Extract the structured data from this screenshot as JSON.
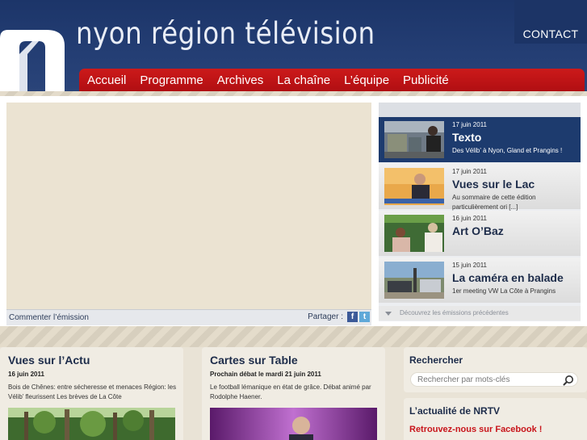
{
  "header": {
    "site_title": "nyon région télévision",
    "contact_label": "CONTACT"
  },
  "nav": {
    "items": [
      "Accueil",
      "Programme",
      "Archives",
      "La chaîne",
      "L’équipe",
      "Publicité"
    ]
  },
  "player": {
    "comment_label": "Commenter l’émission",
    "share_label": "Partager :"
  },
  "episodes": [
    {
      "date": "17 juin 2011",
      "title": "Texto",
      "desc": "Des Vélib’ à Nyon, Gland et Prangins !",
      "active": true
    },
    {
      "date": "17 juin 2011",
      "title": "Vues sur le Lac",
      "desc": "Au sommaire de cette édition particulièrement ori [...]",
      "active": false
    },
    {
      "date": "16 juin 2011",
      "title": "Art O’Baz",
      "desc": "",
      "active": false
    },
    {
      "date": "15 juin 2011",
      "title": "La caméra en balade",
      "desc": "1er meeting VW La Côte à Prangins",
      "active": false
    }
  ],
  "episodes_more": "Découvrez les émissions précédentes",
  "cards": {
    "actu": {
      "title": "Vues sur l’Actu",
      "sub": "16 juin 2011",
      "text": "Bois de Chênes: entre sécheresse et menaces Région: les Vélib’ fleurissent Les brèves de La Côte"
    },
    "cartes": {
      "title": "Cartes sur Table",
      "sub": "Prochain débat le mardi 21 juin 2011",
      "text": "Le football lémanique en état de grâce. Débat animé par Rodolphe Haener."
    }
  },
  "search": {
    "title": "Rechercher",
    "placeholder": "Rechercher par mots-clés"
  },
  "news": {
    "title": "L’actualité de NRTV",
    "facebook_link": "Retrouvez-nous sur Facebook !"
  },
  "colors": {
    "header_blue": "#1f3a6e",
    "nav_red": "#c4161c",
    "active_episode": "#1d3b6e",
    "link_red": "#c8141a"
  }
}
